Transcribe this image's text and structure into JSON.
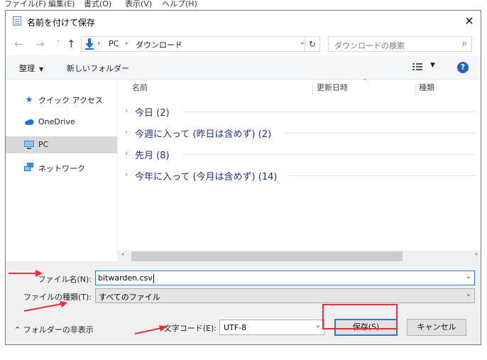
{
  "background": {
    "menu": [
      "ファイル(F)",
      "編集(E)",
      "書式(O)",
      "表示(V)",
      "ヘルプ(H)"
    ]
  },
  "dialog": {
    "title": "名前を付けて保存",
    "close": "✕"
  },
  "nav": {
    "back": "←",
    "forward": "→",
    "recent": "⌄",
    "up": "↑",
    "breadcrumb": [
      "PC",
      "ダウンロード"
    ],
    "sep": "›",
    "dropdown": "⌄",
    "refresh": "↻",
    "search_placeholder": "ダウンロードの検索",
    "search_glyph": "⌕"
  },
  "toolbar": {
    "organize": "整理",
    "new_folder": "新しいフォルダー",
    "help": "?"
  },
  "sidebar": {
    "items": [
      {
        "label": "クイック アクセス",
        "icon": "star-icon"
      },
      {
        "label": "OneDrive",
        "icon": "cloud-icon"
      },
      {
        "label": "PC",
        "icon": "computer-icon",
        "selected": true
      },
      {
        "label": "ネットワーク",
        "icon": "network-icon"
      }
    ]
  },
  "filelist": {
    "columns": [
      "名前",
      "更新日時",
      "種類"
    ],
    "groups": [
      {
        "label": "今日 (2)"
      },
      {
        "label": "今週に入って (昨日は含めず) (2)"
      },
      {
        "label": "先月 (8)"
      },
      {
        "label": "今年に入って (今月は含めず) (14)"
      }
    ]
  },
  "form": {
    "filename_label": "ファイル名(N):",
    "filename_value": "bitwarden.csv",
    "filetype_label": "ファイルの種類(T):",
    "filetype_value": "すべてのファイル",
    "encoding_label": "文字コード(E):",
    "encoding_value": "UTF-8",
    "hide_folders": "フォルダーの非表示",
    "save": "保存(S)",
    "cancel": "キャンセル"
  },
  "annotation_color": "#e0303c"
}
